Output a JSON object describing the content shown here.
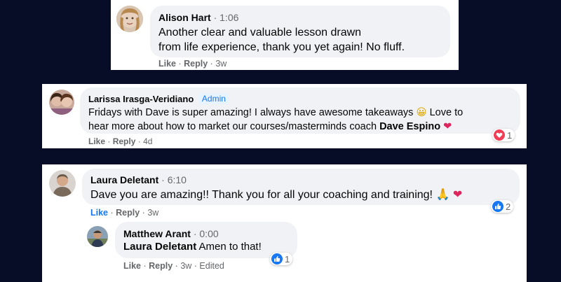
{
  "comments": [
    {
      "author": "Alison Hart",
      "timestamp": "1:06",
      "lines": [
        "Another clear and valuable lesson drawn",
        "from life experience, thank you yet again! No fluff."
      ],
      "like_label": "Like",
      "reply_label": "Reply",
      "age": "3w"
    },
    {
      "author": "Larissa Irasga-Veridiano",
      "badge": "Admin",
      "line1": "Fridays with Dave is super amazing! I always have awesome takeaways",
      "line1_emoji": "😀",
      "line1_tail": "Love to",
      "line2_pre": "hear more about how to market our courses/masterminds coach",
      "mention": "Dave Espino",
      "line2_emoji": "❤",
      "like_label": "Like",
      "reply_label": "Reply",
      "age": "4d",
      "reaction_count": "1"
    },
    {
      "author": "Laura Deletant",
      "timestamp": "6:10",
      "text": "Dave you are amazing!! Thank you for all your coaching and training!",
      "emoji1": "🙏",
      "emoji2": "❤",
      "like_label": "Like",
      "reply_label": "Reply",
      "age": "3w",
      "reaction_count": "2"
    }
  ],
  "reply": {
    "author": "Matthew Arant",
    "timestamp": "0:00",
    "mention": "Laura Deletant",
    "text": "Amen to that!",
    "like_label": "Like",
    "reply_label": "Reply",
    "age": "3w",
    "edited_label": "Edited",
    "reaction_count": "1"
  },
  "colors": {
    "background": "#070d26",
    "bubble": "#f0f2f5",
    "like_blue": "#1877f2",
    "love_red": "#f33e58",
    "secondary_text": "#65676b"
  }
}
